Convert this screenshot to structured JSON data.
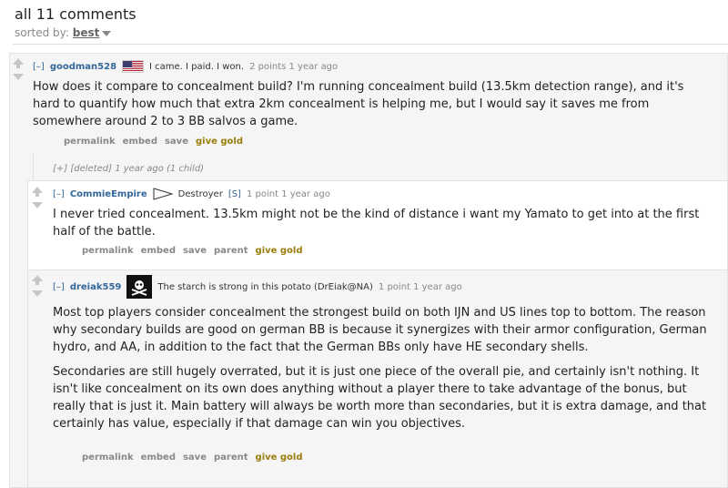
{
  "header": {
    "comment_count": "all 11 comments",
    "sorted_by_label": "sorted by:",
    "sorted_by_value": "best"
  },
  "comments": [
    {
      "toggle": "[–]",
      "author": "goodman528",
      "flair_icon": "us-flag-icon",
      "flair": "I came. I paid. I won.",
      "score_time": "2 points 1 year ago",
      "body": "How does it compare to concealment build? I'm running concealment build (13.5km detection range), and it's hard to quantify how much that extra 2km concealment is helping me, but I would say it saves me from somewhere around 2 to 3 BB salvos a game.",
      "buttons": [
        "permalink",
        "embed",
        "save",
        "give gold"
      ]
    },
    {
      "collapsed": "[+] [deleted] 1 year ago (1 child)"
    },
    {
      "toggle": "[–]",
      "author": "CommieEmpire",
      "flair_icon": "destroyer-flag-icon",
      "flair": "Destroyer",
      "tag": "[S]",
      "score_time": "1 point 1 year ago",
      "body": "I never tried concealment. 13.5km might not be the kind of distance i want my Yamato to get into at the first half of the battle.",
      "buttons": [
        "permalink",
        "embed",
        "save",
        "parent",
        "give gold"
      ]
    },
    {
      "toggle": "[–]",
      "author": "dreiak559",
      "flair_icon": "jolly-roger-icon",
      "flair": "The starch is strong in this potato (DrEiak@NA)",
      "score_time": "1 point 1 year ago",
      "paragraphs": [
        "Most top players consider concealment the strongest build on both IJN and US lines top to bottom. The reason why secondary builds are good on german BB is because it synergizes with their armor configuration, German hydro, and AA, in addition to the fact that the German BBs only have HE secondary shells.",
        "Secondaries are still hugely overrated, but it is just one piece of the overall pie, and certainly isn't nothing. It isn't like concealment on its own does anything without a player there to take advantage of the bonus, but really that is just it. Main battery will always be worth more than secondaries, but it is extra damage, and that certainly has value, especially if that damage can win you objectives."
      ],
      "buttons": [
        "permalink",
        "embed",
        "save",
        "parent",
        "give gold"
      ]
    }
  ]
}
